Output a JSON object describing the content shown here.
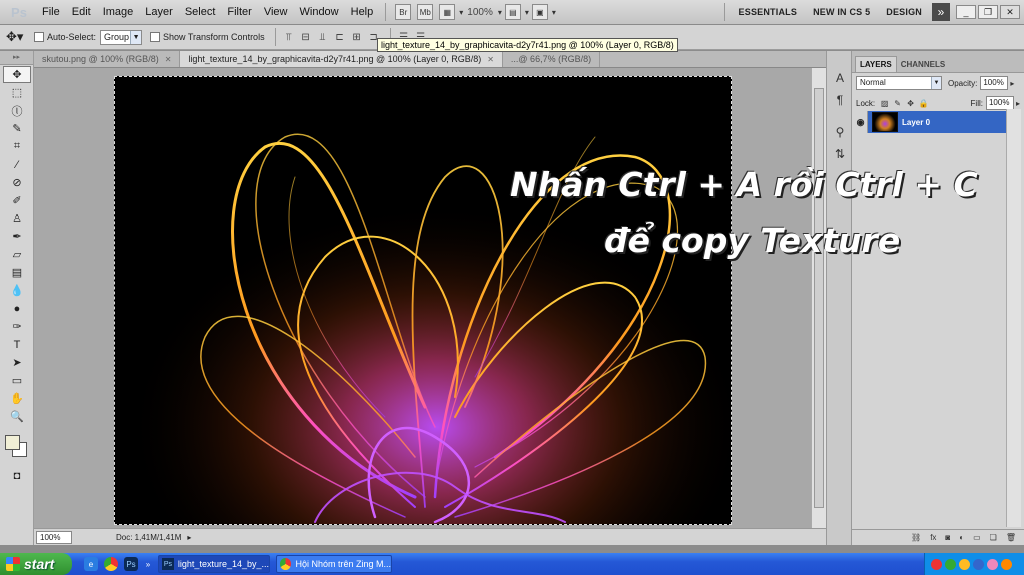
{
  "app": {
    "logo": "Ps"
  },
  "menu": [
    "File",
    "Edit",
    "Image",
    "Layer",
    "Select",
    "Filter",
    "View",
    "Window",
    "Help"
  ],
  "menubar": {
    "bridge_label": "Br",
    "minibridge_label": "Mb",
    "zoom": "100%",
    "workspaces": [
      "ESSENTIALS",
      "NEW IN CS 5",
      "DESIGN"
    ],
    "more_glyph": "»"
  },
  "options": {
    "auto_select_label": "Auto-Select:",
    "auto_select_value": "Group",
    "show_transform_label": "Show Transform Controls"
  },
  "tooltip": "light_texture_14_by_graphicavita-d2y7r41.png @ 100% (Layer 0, RGB/8)",
  "tabs": [
    {
      "label": "skutou.png @ 100% (RGB/8)"
    },
    {
      "label": "light_texture_14_by_graphicavita-d2y7r41.png @ 100% (Layer 0, RGB/8)"
    },
    {
      "label": "...@ 66,7% (RGB/8)"
    }
  ],
  "canvas": {
    "overlay_line1": "Nhấn Ctrl + A rồi Ctrl + C",
    "overlay_line2": "để copy Texture"
  },
  "status": {
    "zoom": "100%",
    "doc": "Doc: 1,41M/1,41M"
  },
  "colors": {
    "foreground": "#f1efd6",
    "background": "#ffffff",
    "layer_selected": "#3466c4"
  },
  "layers_panel": {
    "tabs": [
      "LAYERS",
      "CHANNELS"
    ],
    "blend_mode": "Normal",
    "opacity_label": "Opacity:",
    "opacity_value": "100%",
    "lock_label": "Lock:",
    "fill_label": "Fill:",
    "fill_value": "100%",
    "layers": [
      {
        "name": "Layer 0"
      }
    ]
  },
  "taskbar": {
    "start_label": "start",
    "tasks": [
      {
        "label": "light_texture_14_by_...",
        "icon": "Ps"
      },
      {
        "label": "Hội Nhóm trên Zing M...",
        "icon": "chrome"
      }
    ]
  }
}
